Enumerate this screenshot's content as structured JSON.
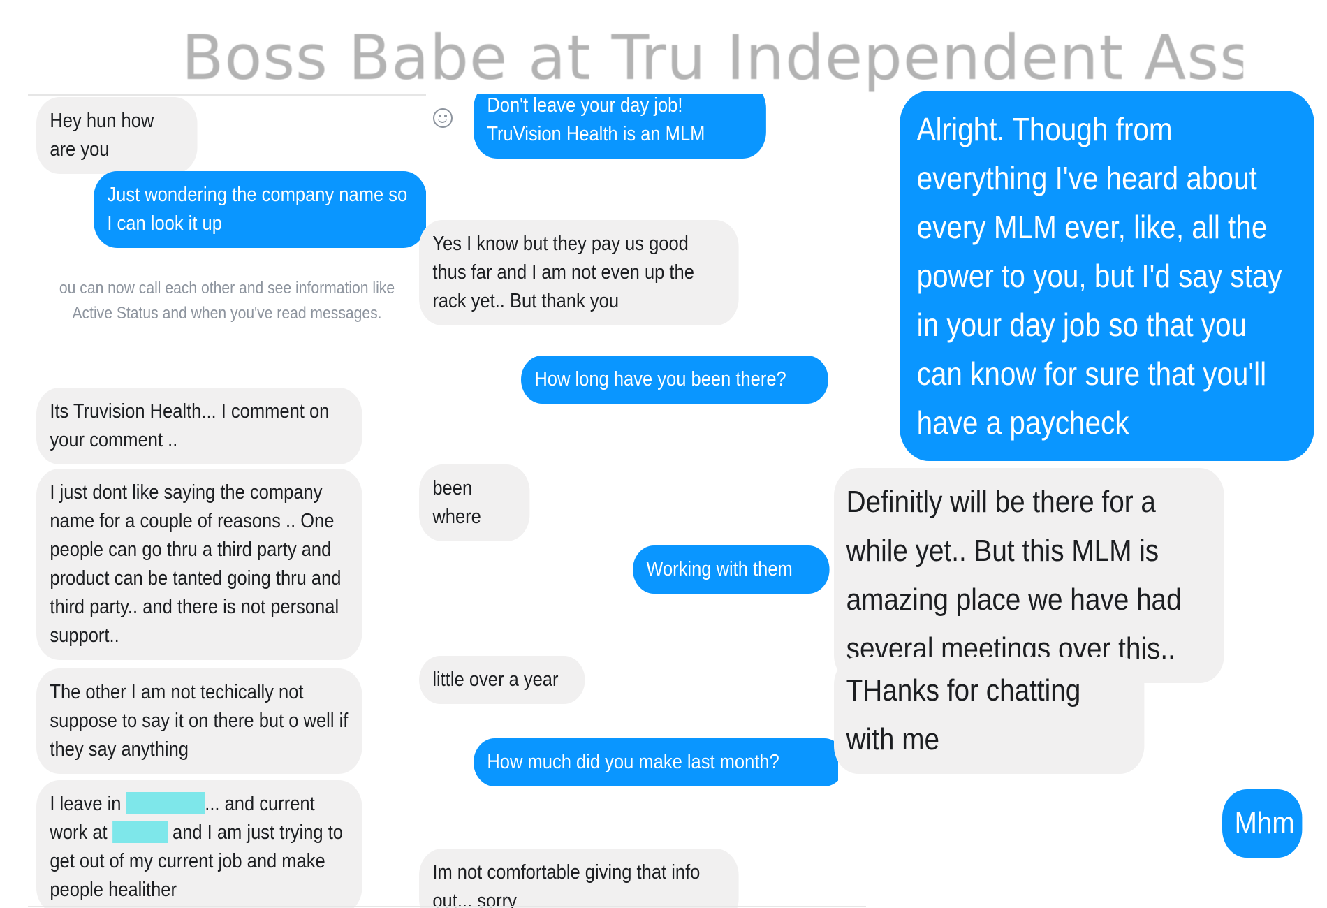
{
  "title": "Boss Babe at Tru Independent Associate ‹",
  "colors": {
    "outgoing": "#0a96ff",
    "incoming": "#f1f0f0",
    "title": "#9a9a9a",
    "redaction": "#7ee7ea"
  },
  "left_panel": {
    "messages": [
      {
        "text": "Hey hun how are you",
        "sender": "them"
      },
      {
        "text": "Just wondering the company name so I can look it up",
        "sender": "me"
      },
      {
        "text": "Its Truvision Health... I comment on your comment ..",
        "sender": "them"
      },
      {
        "text": "I just dont like saying the company name for a couple of reasons .. One people can go thru a third party and product can be tanted going thru and third party.. and there is not personal support..",
        "sender": "them"
      },
      {
        "text": "The other I am not techically not suppose to say it on there but o well if they say anything",
        "sender": "them"
      }
    ],
    "notice": "ou can now call each other and see information like Active Status and when you've read messages.",
    "redacted_message": {
      "part1": "I leave in",
      "part2": "... and current work at",
      "part3": "and I am just trying to get out of my current job and make people healither"
    }
  },
  "middle_panel": {
    "emoji_icon": "smiley-icon",
    "messages": [
      {
        "text": "Don't leave your day job! TruVision Health is an MLM",
        "sender": "me"
      },
      {
        "text": "Yes I know but they pay us good thus far and I am not even up the rack yet.. But thank you",
        "sender": "them"
      },
      {
        "text": "How long have you been there?",
        "sender": "me"
      },
      {
        "text": "been where",
        "sender": "them"
      },
      {
        "text": "Working with them",
        "sender": "me"
      },
      {
        "text": "little over a year",
        "sender": "them"
      },
      {
        "text": "How much did you make last month?",
        "sender": "me"
      },
      {
        "text": "Im not comfortable giving that info out... sorry",
        "sender": "them"
      }
    ]
  },
  "right_panel": {
    "messages": [
      {
        "text": "Alright. Though from everything I've heard about every MLM ever, like, all the power to you, but I'd say stay in your day job so that you can know for sure that you'll have a paycheck",
        "sender": "me"
      },
      {
        "text": "Definitly will be there for a while yet.. But this MLM is amazing place we have had several meetings over this..",
        "sender": "them"
      },
      {
        "text": "THanks for chatting with me",
        "sender": "them"
      },
      {
        "text": "Mhm",
        "sender": "me"
      }
    ]
  }
}
